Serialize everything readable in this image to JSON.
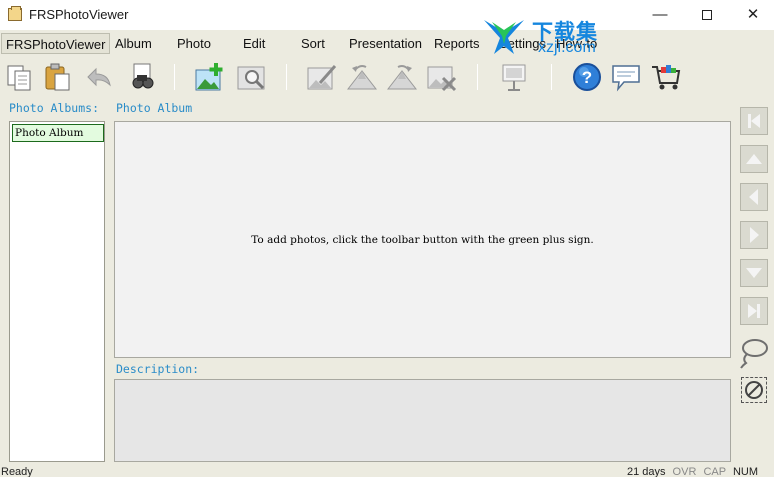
{
  "window": {
    "title": "FRSPhotoViewer",
    "minimize": "—",
    "close": "✕"
  },
  "menu": [
    "FRSPhotoViewer",
    "Album",
    "Photo",
    "Edit",
    "Sort",
    "Presentation",
    "Reports",
    "Settings",
    "How-to"
  ],
  "watermark": {
    "text": "下载集",
    "sub": "xzji.com"
  },
  "toolbar_icons": [
    "copy-icon",
    "paste-icon",
    "undo-icon",
    "find-icon",
    "add-photo-icon",
    "zoom-photo-icon",
    "edit-photo-icon",
    "rotate-left-icon",
    "rotate-right-icon",
    "delete-photo-icon",
    "presentation-icon",
    "help-icon",
    "comment-icon",
    "shopping-cart-icon"
  ],
  "labels": {
    "photo_albums": "Photo Albums:",
    "photo_album": "Photo Album",
    "description": "Description:"
  },
  "albums": [
    {
      "name": "Photo Album",
      "selected": true
    }
  ],
  "album_hint": "To add photos, click the toolbar button with the green plus sign.",
  "nav_buttons": [
    "first-icon",
    "up-icon",
    "previous-icon",
    "next-icon",
    "down-icon",
    "last-icon"
  ],
  "status": {
    "left": "Ready",
    "days": "21 days",
    "ovr": "OVR",
    "cap": "CAP",
    "num": "NUM"
  },
  "colors": {
    "label_blue": "#2a8cc8",
    "selection_green": "#e3fbdf",
    "add_green": "#3bb03b",
    "help_blue": "#2f7fd8",
    "background": "#ecebe0"
  }
}
